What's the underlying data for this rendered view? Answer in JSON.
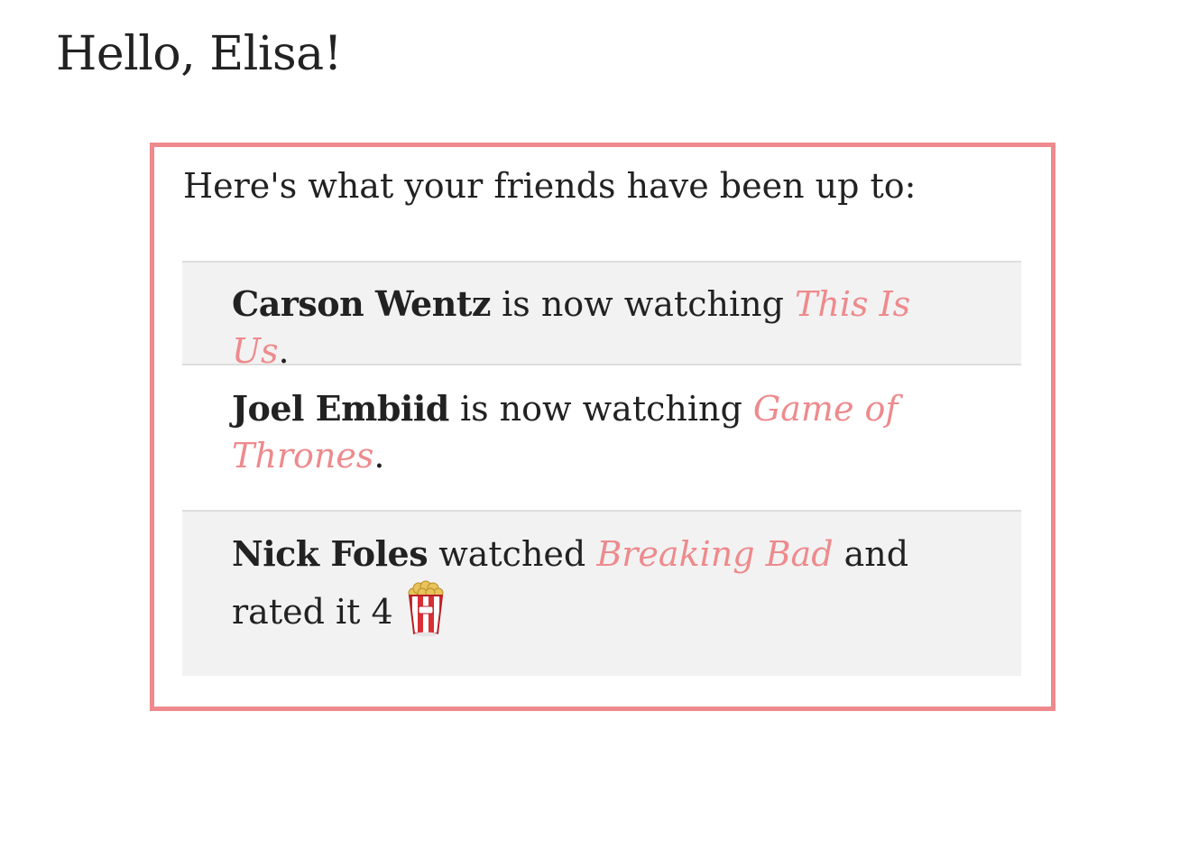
{
  "header": {
    "greeting": "Hello, Elisa!"
  },
  "feed": {
    "intro": "Here's what your friends have been up to:",
    "items": [
      {
        "friend": "Carson Wentz",
        "action": "is now watching",
        "show": "This Is Us",
        "end": "."
      },
      {
        "friend": "Joel Embiid",
        "action": "is now watching",
        "show": "Game of Thrones",
        "end": "."
      },
      {
        "friend": "Nick Foles",
        "action": "watched",
        "show": "Breaking Bad",
        "rating_text": "and rated it 4",
        "rating_icon": "popcorn-icon"
      }
    ]
  },
  "colors": {
    "accent": "#ee8a8d",
    "row_shade": "#f2f2f2",
    "divider": "#dddddd",
    "text": "#222222"
  }
}
